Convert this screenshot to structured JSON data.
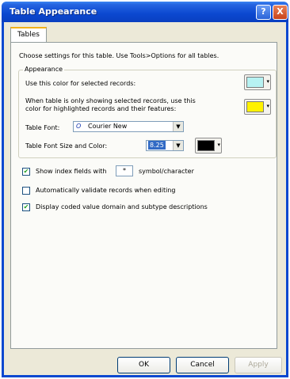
{
  "window": {
    "title": "Table Appearance",
    "help_glyph": "?",
    "close_glyph": "X"
  },
  "tabs": [
    {
      "label": "Tables"
    }
  ],
  "intro_text": "Choose settings for this table. Use Tools>Options for all tables.",
  "appearance": {
    "group_label": "Appearance",
    "selected_color_label": "Use this color for selected records:",
    "selected_color": "#b7f2f2",
    "highlight_label_line1": "When table is only showing selected records, use this",
    "highlight_label_line2": "color for highlighted records and their features:",
    "highlight_color": "#fff200",
    "font_label": "Table Font:",
    "font_value": "Courier New",
    "size_color_label": "Table Font Size and Color:",
    "size_value": "8.25",
    "font_color": "#000000"
  },
  "options": {
    "show_index": {
      "label_prefix": "Show index fields with",
      "symbol": "*",
      "label_suffix": "symbol/character",
      "checked": true
    },
    "auto_validate": {
      "label": "Automatically validate records when editing",
      "checked": false
    },
    "coded_values": {
      "label": "Display coded value domain and subtype descriptions",
      "checked": true
    }
  },
  "buttons": {
    "ok": "OK",
    "cancel": "Cancel",
    "apply": "Apply"
  },
  "glyphs": {
    "check": "✔",
    "dropdown": "▼",
    "small_arrow": "▾",
    "font_icon": "O"
  }
}
